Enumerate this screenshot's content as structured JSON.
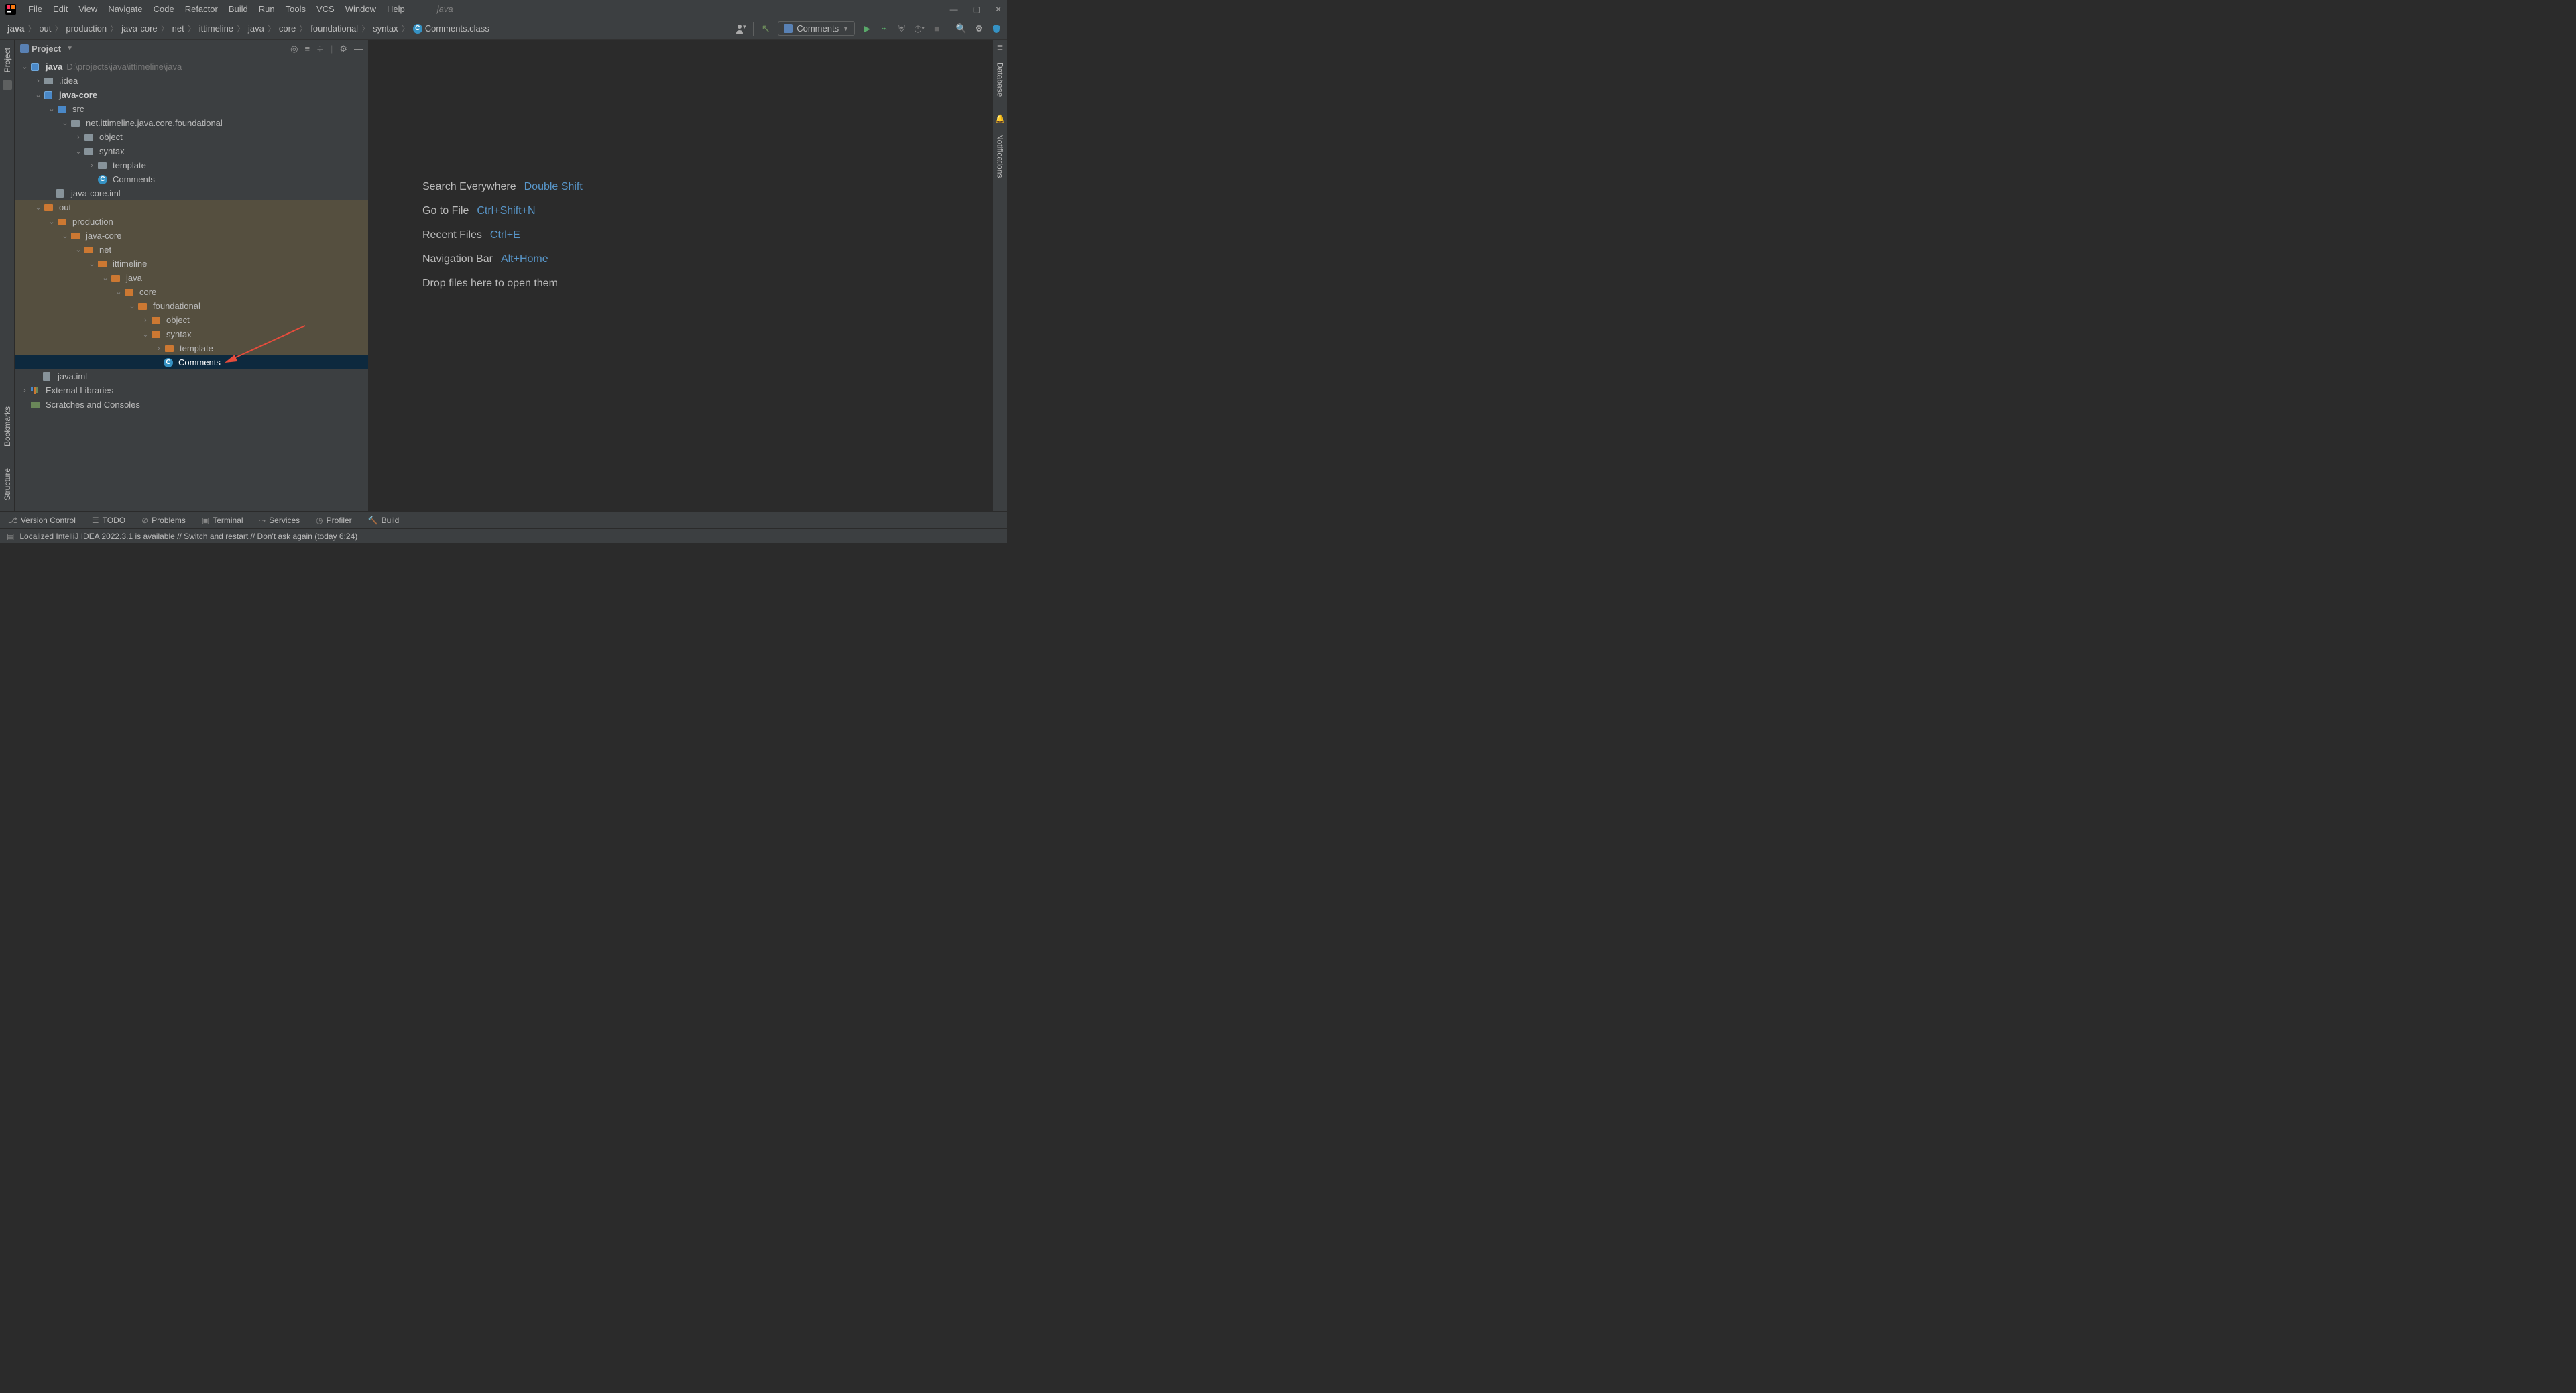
{
  "titlebar": {
    "menus": [
      "File",
      "Edit",
      "View",
      "Navigate",
      "Code",
      "Refactor",
      "Build",
      "Run",
      "Tools",
      "VCS",
      "Window",
      "Help"
    ],
    "project_hint": "java"
  },
  "breadcrumbs": [
    "java",
    "out",
    "production",
    "java-core",
    "net",
    "ittimeline",
    "java",
    "core",
    "foundational",
    "syntax"
  ],
  "breadcrumb_file": "Comments.class",
  "run_config": "Comments",
  "project_panel": {
    "title": "Project",
    "root": {
      "name": "java",
      "path": "D:\\projects\\java\\ittimeline\\java"
    },
    "idea_folder": ".idea",
    "module_javacore": "java-core",
    "src": "src",
    "pkg_foundational": "net.ittimeline.java.core.foundational",
    "pkg_object": "object",
    "pkg_syntax": "syntax",
    "pkg_template": "template",
    "class_comments_src": "Comments",
    "iml_javacore": "java-core.iml",
    "out": "out",
    "production": "production",
    "out_javacore": "java-core",
    "out_net": "net",
    "out_ittimeline": "ittimeline",
    "out_java": "java",
    "out_core": "core",
    "out_foundational": "foundational",
    "out_object": "object",
    "out_syntax": "syntax",
    "out_template": "template",
    "out_comments": "Comments",
    "iml_java": "java.iml",
    "ext_libs": "External Libraries",
    "scratches": "Scratches and Consoles"
  },
  "welcome": {
    "search": "Search Everywhere",
    "search_sc": "Double Shift",
    "goto": "Go to File",
    "goto_sc": "Ctrl+Shift+N",
    "recent": "Recent Files",
    "recent_sc": "Ctrl+E",
    "navbar": "Navigation Bar",
    "navbar_sc": "Alt+Home",
    "drop": "Drop files here to open them"
  },
  "bottom_tools": {
    "vcs": "Version Control",
    "todo": "TODO",
    "problems": "Problems",
    "terminal": "Terminal",
    "services": "Services",
    "profiler": "Profiler",
    "build": "Build"
  },
  "statusbar": {
    "message": "Localized IntelliJ IDEA 2022.3.1 is available // Switch and restart // Don't ask again (today 6:24)"
  },
  "left_stripe": {
    "project": "Project",
    "bookmarks": "Bookmarks",
    "structure": "Structure"
  },
  "right_stripe": {
    "database": "Database",
    "notifications": "Notifications"
  }
}
